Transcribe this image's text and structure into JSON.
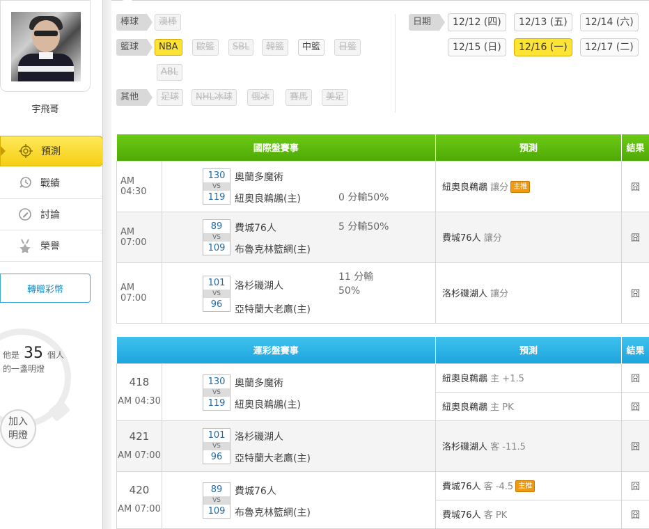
{
  "user": {
    "name": "宇飛哥"
  },
  "menu": [
    {
      "label": "預測",
      "icon": "target-icon",
      "active": true
    },
    {
      "label": "戰績",
      "icon": "history-icon"
    },
    {
      "label": "討論",
      "icon": "chat-edit-icon"
    },
    {
      "label": "榮譽",
      "icon": "medal-icon"
    }
  ],
  "gift_button": "轉贈彩幣",
  "lamp": {
    "prefix": "他是",
    "count": "35",
    "suffix": "個人",
    "line2": "的一盞明燈",
    "join": "加入明燈"
  },
  "filters": {
    "baseball": {
      "label": "棒球",
      "items": [
        {
          "label": "澳棒",
          "state": "disabled"
        }
      ]
    },
    "basketball": {
      "label": "籃球",
      "items": [
        {
          "label": "NBA",
          "state": "selected"
        },
        {
          "label": "歐籃",
          "state": "disabled"
        },
        {
          "label": "SBL",
          "state": "disabled"
        },
        {
          "label": "韓籃",
          "state": "disabled"
        },
        {
          "label": "中籃",
          "state": "enabled"
        },
        {
          "label": "日籃",
          "state": "disabled"
        },
        {
          "label": "ABL",
          "state": "disabled"
        }
      ]
    },
    "other": {
      "label": "其他",
      "items": [
        {
          "label": "足球",
          "state": "disabled"
        },
        {
          "label": "NHL冰球",
          "state": "disabled"
        },
        {
          "label": "俄冰",
          "state": "disabled"
        },
        {
          "label": "賽馬",
          "state": "disabled"
        },
        {
          "label": "美足",
          "state": "disabled"
        }
      ]
    },
    "date": {
      "label": "日期",
      "items": [
        {
          "label": "12/12 (四)"
        },
        {
          "label": "12/13 (五)"
        },
        {
          "label": "12/14 (六)"
        },
        {
          "label": "12/15 (日)"
        },
        {
          "label": "12/16 (一)",
          "selected": true
        },
        {
          "label": "12/17 (二)"
        }
      ]
    }
  },
  "intl_table": {
    "headers": [
      "國際盤賽事",
      "預測",
      "結果"
    ],
    "rows": [
      {
        "time": "AM 04:30",
        "score_away": "130",
        "score_home": "119",
        "vs": "VS",
        "away": "奧蘭多魔術",
        "home": "紐奧良鵜鶘(主)",
        "spread": "0 分輸50%",
        "prediction": "紐奧良鵜鶘",
        "pick": "讓分",
        "hot": "主推",
        "result": "囧"
      },
      {
        "time": "AM 07:00",
        "score_away": "89",
        "score_home": "109",
        "vs": "VS",
        "away": "費城76人",
        "home": "布魯克林籃網(主)",
        "spread": "5 分輸50%",
        "prediction": "費城76人",
        "pick": "讓分",
        "result": "囧"
      },
      {
        "time": "AM 07:00",
        "score_away": "101",
        "score_home": "96",
        "vs": "VS",
        "away": "洛杉磯湖人",
        "home": "亞特蘭大老鷹(主)",
        "spread": "11 分輸 50%",
        "prediction": "洛杉磯湖人",
        "pick": "讓分",
        "result": "囧"
      }
    ]
  },
  "sports_lottery_table": {
    "headers": [
      "運彩盤賽事",
      "預測",
      "結果"
    ],
    "games": [
      {
        "id": "418",
        "time": "AM 04:30",
        "score_away": "130",
        "score_home": "119",
        "vs": "VS",
        "away": "奧蘭多魔術",
        "home": "紐奧良鵜鶘(主)",
        "predictions": [
          {
            "team": "紐奧良鵜鶘",
            "pick": "主 +1.5",
            "result": "囧"
          },
          {
            "team": "紐奧良鵜鶘",
            "pick": "主 PK",
            "result": "囧"
          }
        ]
      },
      {
        "id": "421",
        "time": "AM 07:00",
        "score_away": "101",
        "score_home": "96",
        "vs": "VS",
        "away": "洛杉磯湖人",
        "home": "亞特蘭大老鷹(主)",
        "predictions": [
          {
            "team": "洛杉磯湖人",
            "pick": "客 -11.5",
            "result": "囧"
          }
        ]
      },
      {
        "id": "420",
        "time": "AM 07:00",
        "score_away": "89",
        "score_home": "109",
        "vs": "VS",
        "away": "費城76人",
        "home": "布魯克林籃網(主)",
        "predictions": [
          {
            "team": "費城76人",
            "pick": "客 -4.5",
            "hot": "主推",
            "result": "囧"
          },
          {
            "team": "費城76人",
            "pick": "客 PK",
            "result": "囧"
          }
        ]
      }
    ]
  },
  "colors": {
    "green_header": "#5bb80c",
    "blue_header": "#2bb1e6",
    "selected_chip": "#fde434",
    "hot_badge": "#f09a12"
  }
}
